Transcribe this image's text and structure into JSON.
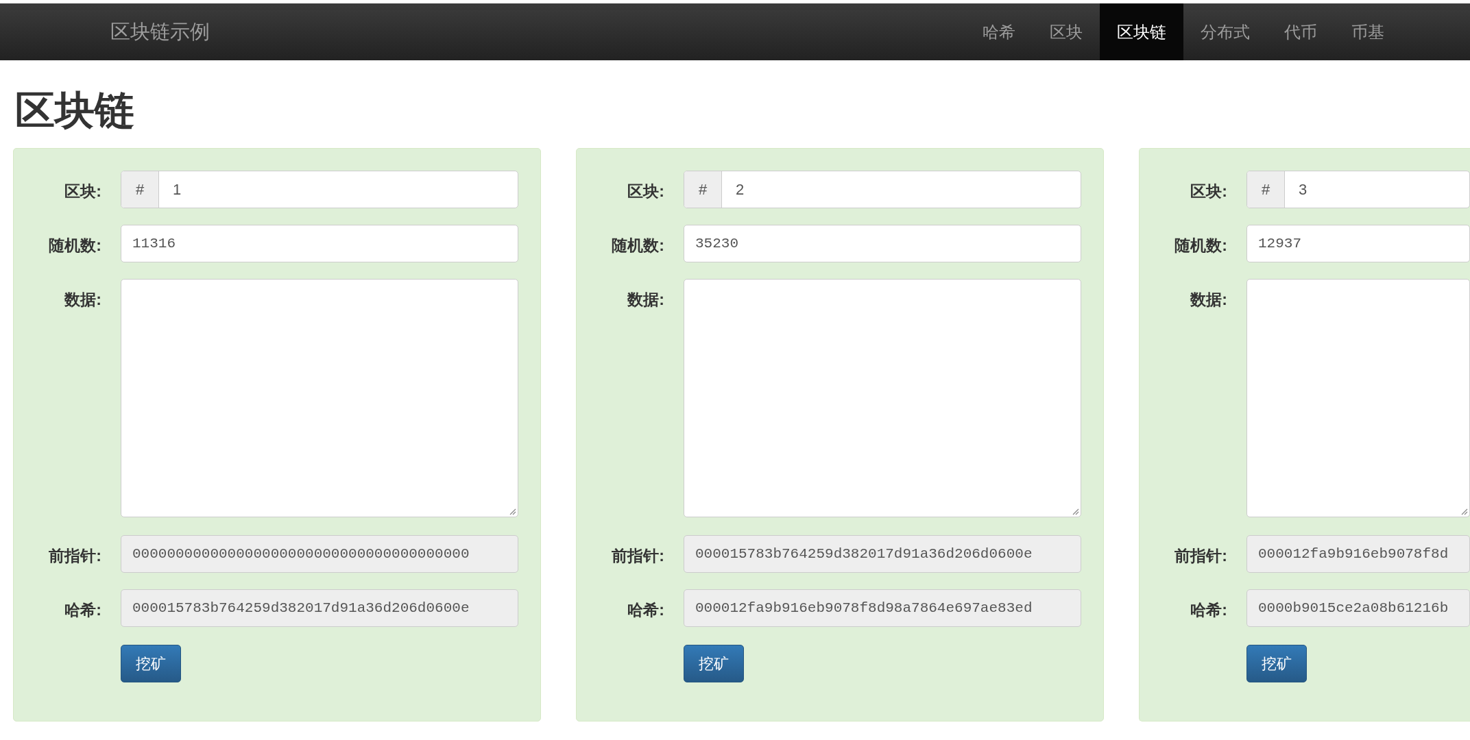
{
  "navbar": {
    "brand": "区块链示例",
    "items": [
      {
        "label": "哈希",
        "selected": false
      },
      {
        "label": "区块",
        "selected": false
      },
      {
        "label": "区块链",
        "selected": true
      },
      {
        "label": "分布式",
        "selected": false
      },
      {
        "label": "代币",
        "selected": false
      },
      {
        "label": "币基",
        "selected": false
      }
    ]
  },
  "page_title": "区块链",
  "blocks": [
    {
      "block_label": "区块:",
      "block_prefix": "#",
      "block_number": "1",
      "nonce_label": "随机数:",
      "nonce": "11316",
      "data_label": "数据:",
      "prev_label": "前指针:",
      "prev": "000000000000000000000000000000000000000",
      "hash_label": "哈希:",
      "hash": "000015783b764259d382017d91a36d206d0600e",
      "button": "挖矿"
    },
    {
      "block_label": "区块:",
      "block_prefix": "#",
      "block_number": "2",
      "nonce_label": "随机数:",
      "nonce": "35230",
      "data_label": "数据:",
      "prev_label": "前指针:",
      "prev": "000015783b764259d382017d91a36d206d0600e",
      "hash_label": "哈希:",
      "hash": "000012fa9b916eb9078f8d98a7864e697ae83ed",
      "button": "挖矿"
    },
    {
      "block_label": "区块:",
      "block_prefix": "#",
      "block_number": "3",
      "nonce_label": "随机数:",
      "nonce": "12937",
      "data_label": "数据:",
      "prev_label": "前指针:",
      "prev": "000012fa9b916eb9078f8d",
      "hash_label": "哈希:",
      "hash": "0000b9015ce2a08b61216b",
      "button": "挖矿"
    }
  ]
}
